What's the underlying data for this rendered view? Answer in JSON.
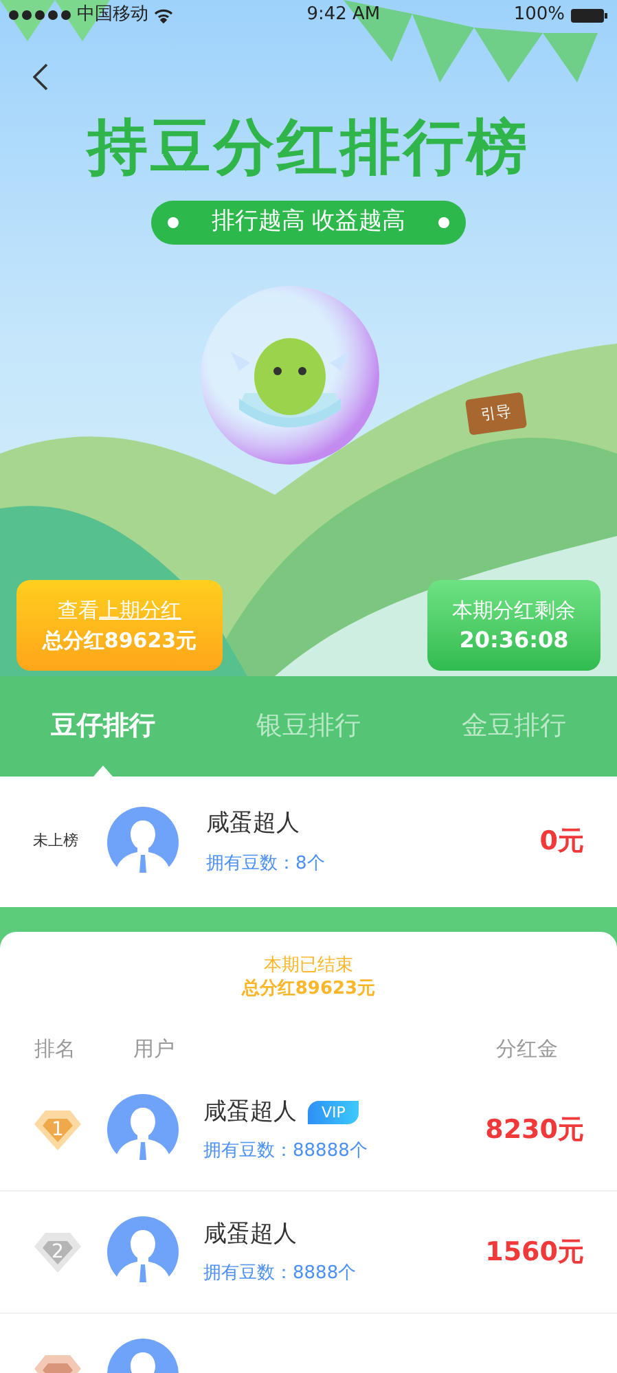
{
  "status_bar": {
    "carrier": "中国移动",
    "time": "9:42 AM",
    "battery": "100%"
  },
  "header": {
    "title": "持豆分红排行榜",
    "slogan": "排行越高 收益越高",
    "sign": "引导"
  },
  "cards": {
    "last": {
      "prefix": "查看",
      "link": "上期分红",
      "total": "总分红89623元"
    },
    "countdown": {
      "label": "本期分红剩余",
      "time": "20:36:08"
    }
  },
  "tabs": [
    {
      "label": "豆仔排行",
      "selected": true
    },
    {
      "label": "银豆排行",
      "selected": false
    },
    {
      "label": "金豆排行",
      "selected": false
    }
  ],
  "my_rank": {
    "status": "未上榜",
    "name": "咸蛋超人",
    "beans": "拥有豆数：8个",
    "amount": "0元"
  },
  "board": {
    "notice": "本期已结束",
    "total": "总分红89623元",
    "columns": [
      "排名",
      "用户",
      "分红金"
    ],
    "rows": [
      {
        "kind": "gold",
        "rank": "1",
        "name": "咸蛋超人",
        "vip": "VIP",
        "beans": "拥有豆数：88888个",
        "amount": "8230元"
      },
      {
        "kind": "silver",
        "rank": "2",
        "name": "咸蛋超人",
        "beans": "拥有豆数：8888个",
        "amount": "1560元"
      },
      {
        "kind": "bronze"
      }
    ]
  }
}
